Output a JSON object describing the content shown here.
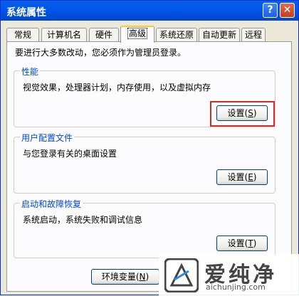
{
  "window": {
    "title": "系统属性",
    "help_glyph": "?",
    "close_glyph": "✕"
  },
  "tabs": [
    {
      "label": "常规",
      "active": false
    },
    {
      "label": "计算机名",
      "active": false
    },
    {
      "label": "硬件",
      "active": false
    },
    {
      "label": "高级",
      "active": true
    },
    {
      "label": "系统还原",
      "active": false
    },
    {
      "label": "自动更新",
      "active": false
    },
    {
      "label": "远程",
      "active": false
    }
  ],
  "advanced": {
    "admin_notice": "要进行大多数改动，您必须作为管理员登录。",
    "performance": {
      "title": "性能",
      "description": "视觉效果，处理器计划，内存使用，以及虚拟内存",
      "button_label": "设置",
      "button_key": "S"
    },
    "user_profiles": {
      "title": "用户配置文件",
      "description": "与您登录有关的桌面设置",
      "button_label": "设置",
      "button_key": "E"
    },
    "startup_recovery": {
      "title": "启动和故障恢复",
      "description": "系统启动，系统失败和调试信息",
      "button_label": "设置",
      "button_key": "T"
    },
    "env_button": {
      "label": "环境变量",
      "key": "N"
    }
  },
  "watermark": {
    "brand": "爱纯净",
    "url": "aichunjing.com"
  },
  "colors": {
    "title_bar": "#0058EE",
    "group_title": "#0046D5",
    "highlight": "#D52B2B",
    "face": "#ECE9D8"
  }
}
